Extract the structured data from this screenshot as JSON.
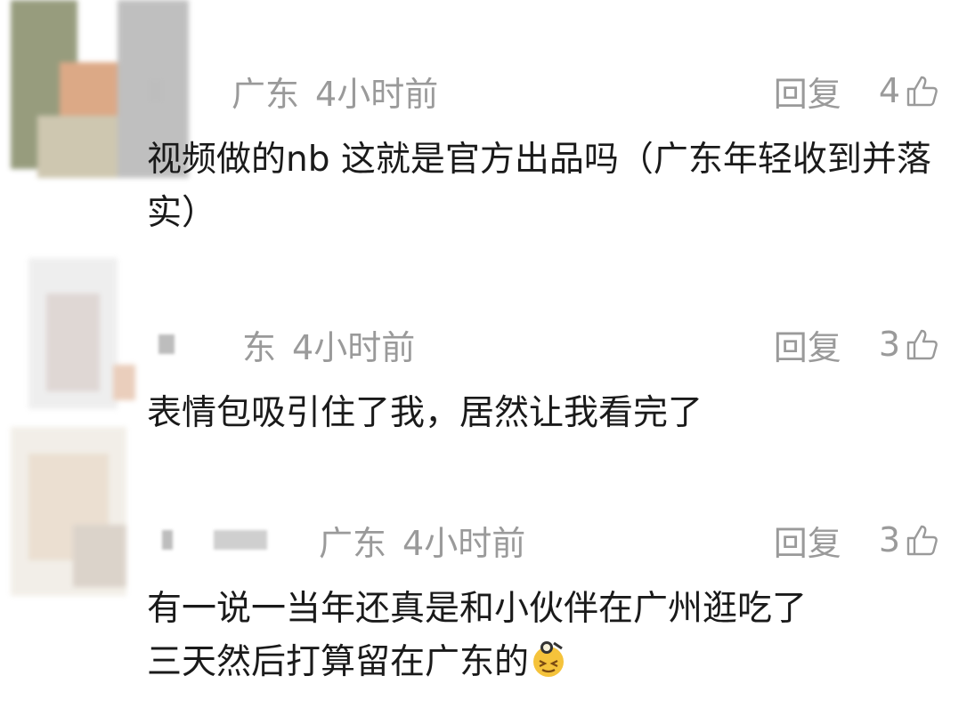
{
  "comments": [
    {
      "location": "广东",
      "time": "4小时前",
      "reply_label": "回复",
      "likes": "4",
      "text": "视频做的nb 这就是官方出品吗（广东年轻收到并落实）",
      "like_icon": "thumbs-up-icon"
    },
    {
      "location": "东",
      "time": "4小时前",
      "reply_label": "回复",
      "likes": "3",
      "text": "表情包吸引住了我，居然让我看完了",
      "like_icon": "thumbs-up-icon"
    },
    {
      "location": "广东",
      "time": "4小时前",
      "reply_label": "回复",
      "likes": "3",
      "text_line1": "有一说一当年还真是和小伙伴在广州逛吃了",
      "text_line2": "三天然后打算留在广东的",
      "like_icon": "thumbs-up-icon",
      "emoji": "laughing-face-emoji"
    }
  ],
  "colors": {
    "meta_text": "#9a9a9a",
    "body_text": "#1a1a1a",
    "background": "#ffffff"
  }
}
